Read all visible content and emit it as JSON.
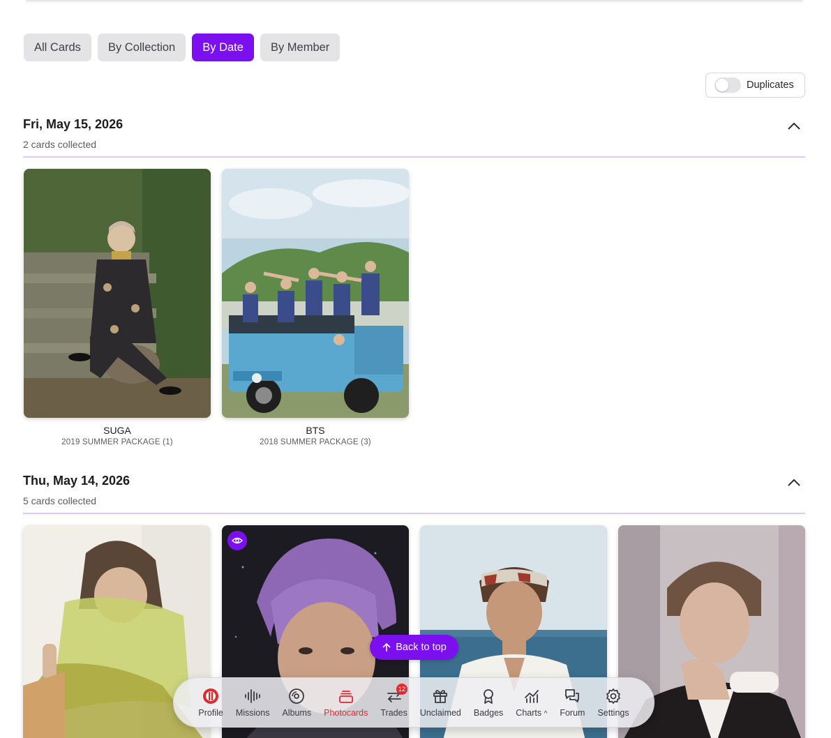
{
  "tabs": [
    {
      "label": "All Cards",
      "active": false
    },
    {
      "label": "By Collection",
      "active": false
    },
    {
      "label": "By Date",
      "active": true
    },
    {
      "label": "By Member",
      "active": false
    }
  ],
  "duplicates_toggle": {
    "label": "Duplicates",
    "on": false
  },
  "sections": [
    {
      "date": "Fri, May 15, 2026",
      "count": "2 cards collected",
      "expanded": true,
      "cards": [
        {
          "name": "SUGA",
          "collection": "2019 SUMMER PACKAGE (1)"
        },
        {
          "name": "BTS",
          "collection": "2018 SUMMER PACKAGE (3)"
        }
      ]
    },
    {
      "date": "Thu, May 14, 2026",
      "count": "5 cards collected",
      "expanded": true,
      "cards": [
        {
          "name": "",
          "collection": ""
        },
        {
          "name": "",
          "collection": "",
          "watched": true
        },
        {
          "name": "",
          "collection": ""
        },
        {
          "name": "",
          "collection": ""
        }
      ]
    }
  ],
  "back_to_top": {
    "label": "Back to top"
  },
  "nav": [
    {
      "label": "Profile",
      "icon": "profile-logo-icon"
    },
    {
      "label": "Missions",
      "icon": "waveform-icon"
    },
    {
      "label": "Albums",
      "icon": "disc-icon"
    },
    {
      "label": "Photocards",
      "icon": "card-stack-icon",
      "active": true
    },
    {
      "label": "Trades",
      "icon": "swap-arrows-icon",
      "badge": "12"
    },
    {
      "label": "Unclaimed",
      "icon": "gift-icon"
    },
    {
      "label": "Badges",
      "icon": "award-icon"
    },
    {
      "label": "Charts",
      "icon": "chart-line-icon",
      "caret": "^"
    },
    {
      "label": "Forum",
      "icon": "chat-bubbles-icon"
    },
    {
      "label": "Settings",
      "icon": "gear-icon"
    }
  ],
  "colors": {
    "accent": "#7c0ff0",
    "active_nav": "#e0282f",
    "divider": "#dcc9f5"
  }
}
